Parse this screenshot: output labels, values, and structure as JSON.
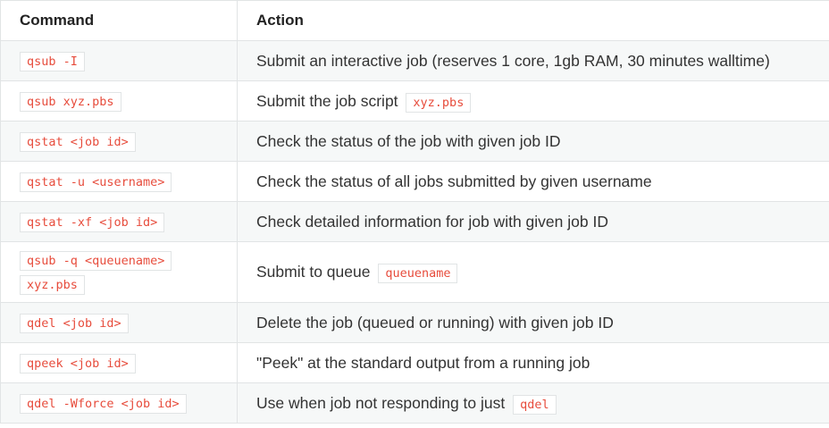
{
  "headers": {
    "command": "Command",
    "action": "Action"
  },
  "rows": [
    {
      "command": "qsub -I",
      "action": "Submit an interactive job (reserves 1 core, 1gb RAM, 30 minutes walltime)"
    },
    {
      "command": "qsub xyz.pbs",
      "action": "Submit the job script",
      "action_code": "xyz.pbs"
    },
    {
      "command": "qstat <job id>",
      "action": "Check the status of the job with given job ID"
    },
    {
      "command": "qstat -u <username>",
      "action": "Check the status of all jobs submitted by given username"
    },
    {
      "command": "qstat -xf <job id>",
      "action": "Check detailed information for job with given job ID"
    },
    {
      "command": "qsub -q <queuename>",
      "command_cont": "xyz.pbs",
      "action": "Submit to queue",
      "action_code": "queuename"
    },
    {
      "command": "qdel <job id>",
      "action": "Delete the job (queued or running) with given job ID"
    },
    {
      "command": "qpeek <job id>",
      "action": "\"Peek\" at the standard output from a running job"
    },
    {
      "command": "qdel -Wforce <job id>",
      "action": "Use when job not responding to just",
      "action_code": "qdel"
    }
  ]
}
